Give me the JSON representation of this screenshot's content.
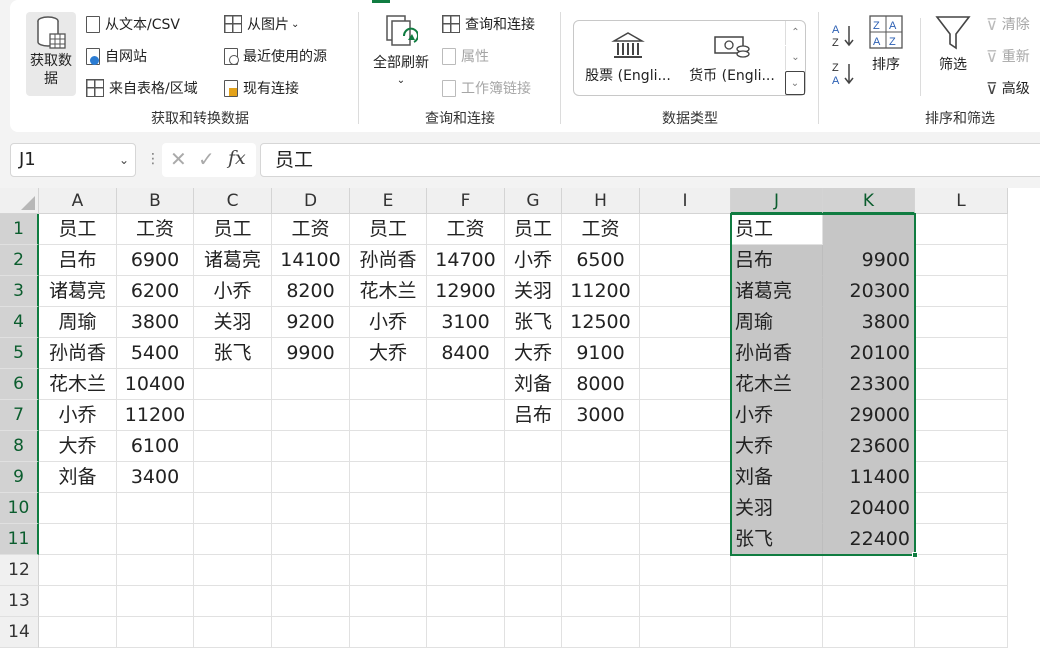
{
  "ribbon": {
    "get_data": "获取数\n据",
    "get_transform": [
      {
        "name": "from-text-csv",
        "label": "从文本/CSV"
      },
      {
        "name": "from-web",
        "label": "自网站"
      },
      {
        "name": "from-table-range",
        "label": "来自表格/区域"
      },
      {
        "name": "from-picture",
        "label": "从图片"
      },
      {
        "name": "recent-sources",
        "label": "最近使用的源"
      },
      {
        "name": "existing-connections",
        "label": "现有连接"
      }
    ],
    "get_transform_label": "获取和转换数据",
    "refresh_all": "全部刷新",
    "queries": [
      {
        "name": "queries-connections",
        "label": "查询和连接"
      },
      {
        "name": "properties",
        "label": "属性"
      },
      {
        "name": "workbook-links",
        "label": "工作簿链接"
      }
    ],
    "queries_label": "查询和连接",
    "data_types": [
      {
        "name": "stocks",
        "label": "股票 (Engli..."
      },
      {
        "name": "currencies",
        "label": "货币 (Engli..."
      }
    ],
    "data_types_label": "数据类型",
    "sort_label": "排序",
    "filter_label": "筛选",
    "clear_label": "清除",
    "reapply_label": "重新",
    "advanced_label": "高级",
    "sort_filter_label": "排序和筛选"
  },
  "formula_bar": {
    "name_box": "J1",
    "fx": "fx",
    "formula": "员工"
  },
  "sheet": {
    "columns": [
      "A",
      "B",
      "C",
      "D",
      "E",
      "F",
      "G",
      "H",
      "I",
      "J",
      "K",
      "L"
    ],
    "rows": [
      "1",
      "2",
      "3",
      "4",
      "5",
      "6",
      "7",
      "8",
      "9",
      "10",
      "11",
      "12",
      "13",
      "14"
    ],
    "cells": {
      "A": [
        "员工",
        "吕布",
        "诸葛亮",
        "周瑜",
        "孙尚香",
        "花木兰",
        "小乔",
        "大乔",
        "刘备"
      ],
      "B": [
        "工资",
        "6900",
        "6200",
        "3800",
        "5400",
        "10400",
        "11200",
        "6100",
        "3400"
      ],
      "C": [
        "员工",
        "诸葛亮",
        "小乔",
        "关羽",
        "张飞"
      ],
      "D": [
        "工资",
        "14100",
        "8200",
        "9200",
        "9900"
      ],
      "E": [
        "员工",
        "孙尚香",
        "花木兰",
        "小乔",
        "大乔"
      ],
      "F": [
        "工资",
        "14700",
        "12900",
        "3100",
        "8400"
      ],
      "G": [
        "员工",
        "小乔",
        "关羽",
        "张飞",
        "大乔",
        "刘备",
        "吕布"
      ],
      "H": [
        "工资",
        "6500",
        "11200",
        "12500",
        "9100",
        "8000",
        "3000"
      ],
      "J": [
        "员工",
        "吕布",
        "诸葛亮",
        "周瑜",
        "孙尚香",
        "花木兰",
        "小乔",
        "大乔",
        "刘备",
        "关羽",
        "张飞"
      ],
      "K": [
        "",
        "9900",
        "20300",
        "3800",
        "20100",
        "23300",
        "29000",
        "23600",
        "11400",
        "20400",
        "22400"
      ]
    }
  }
}
